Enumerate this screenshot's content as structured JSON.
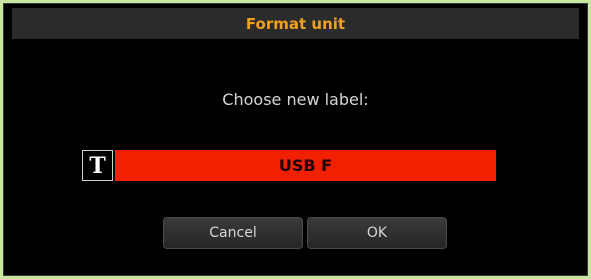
{
  "dialog": {
    "title": "Format unit",
    "prompt": "Choose new label:",
    "text_icon_glyph": "T",
    "label_value": "USB F",
    "buttons": {
      "cancel_label": "Cancel",
      "ok_label": "OK"
    }
  },
  "colors": {
    "accent_title": "#f0a020",
    "field_background": "#f02000",
    "dialog_background": "#000000",
    "outer_background": "#c8e6a0"
  },
  "icons": {
    "text_icon": "text-edit-icon"
  }
}
